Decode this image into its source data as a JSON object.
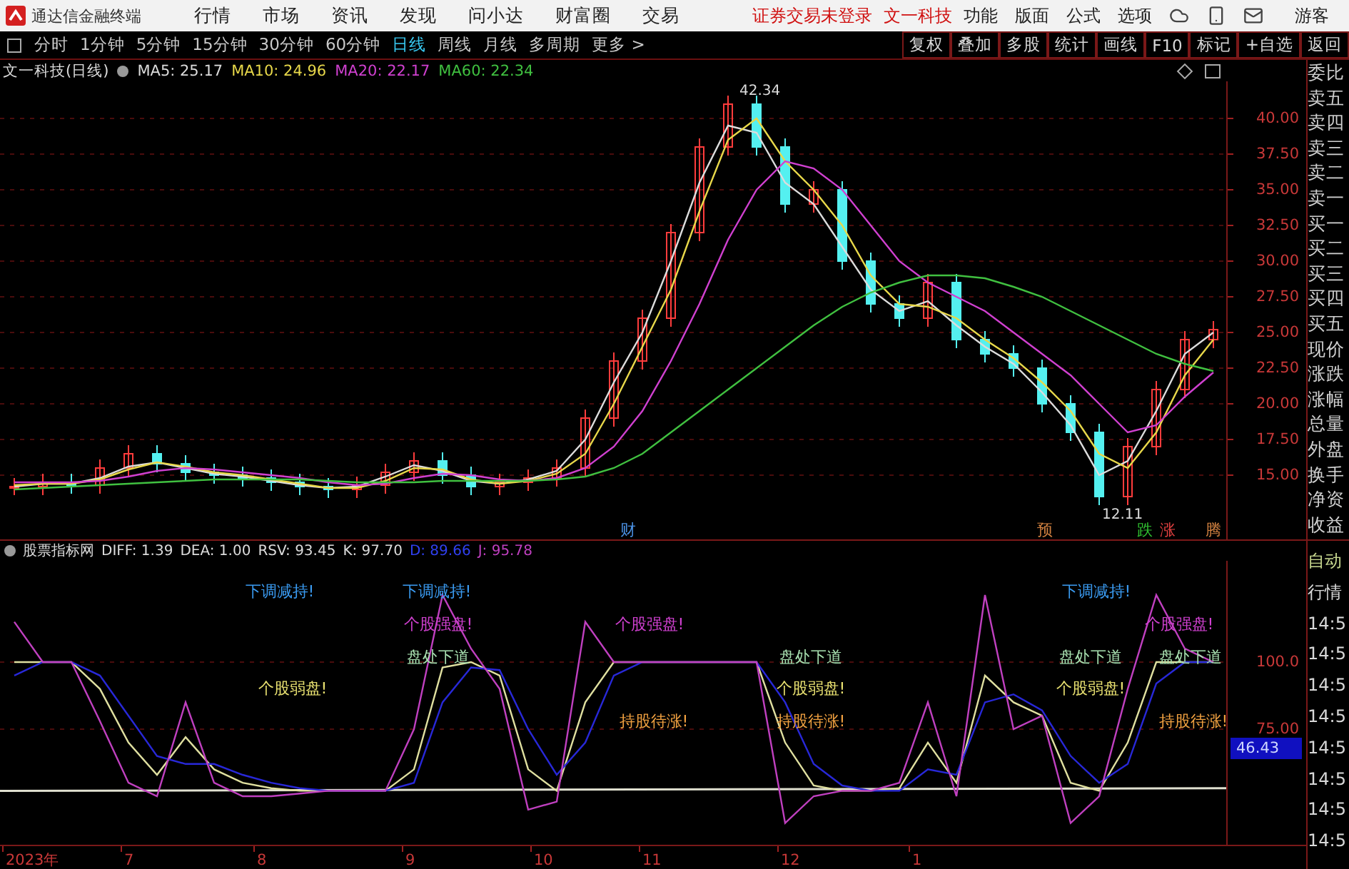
{
  "app_bar": {
    "title": "通达信金融终端",
    "menu": [
      "行情",
      "市场",
      "资讯",
      "发现",
      "问小达",
      "财富圈",
      "交易"
    ],
    "notice": "证券交易未登录",
    "stock": "文一科技",
    "tools": [
      "功能",
      "版面",
      "公式",
      "选项"
    ],
    "user": "游客"
  },
  "period_bar": {
    "periods": [
      {
        "label": "分时",
        "selected": false
      },
      {
        "label": "1分钟",
        "selected": false
      },
      {
        "label": "5分钟",
        "selected": false
      },
      {
        "label": "15分钟",
        "selected": false
      },
      {
        "label": "30分钟",
        "selected": false
      },
      {
        "label": "60分钟",
        "selected": false
      },
      {
        "label": "日线",
        "selected": true
      },
      {
        "label": "周线",
        "selected": false
      },
      {
        "label": "月线",
        "selected": false
      },
      {
        "label": "多周期",
        "selected": false
      },
      {
        "label": "更多 >",
        "selected": false
      }
    ],
    "actions": [
      "复权",
      "叠加",
      "多股",
      "统计",
      "画线",
      "F10",
      "标记",
      "+自选",
      "返回"
    ]
  },
  "price_panel": {
    "title": "文一科技(日线)",
    "indicators": [
      {
        "label": "MA5: 25.17",
        "color": "#dcdcdc"
      },
      {
        "label": "MA10: 24.96",
        "color": "#e8d84a"
      },
      {
        "label": "MA20: 22.17",
        "color": "#d040d0"
      },
      {
        "label": "MA60: 22.34",
        "color": "#40c040"
      }
    ],
    "axis_labels": [
      "40.00",
      "37.50",
      "35.00",
      "32.50",
      "30.00",
      "27.50",
      "25.00",
      "22.50",
      "20.00",
      "17.50",
      "15.00"
    ],
    "price_labels": [
      "42.34",
      "12.11"
    ],
    "event_markers": [
      {
        "text": "财",
        "color": "#4a90e2"
      },
      {
        "text": "预",
        "color": "#d08040"
      },
      {
        "text": "跌",
        "color": "#30c030"
      },
      {
        "text": "涨",
        "color": "#e04040"
      },
      {
        "text": "腾",
        "color": "#d08040"
      }
    ]
  },
  "quote_labels": [
    "委比",
    "卖五",
    "卖四",
    "卖三",
    "卖二",
    "卖一",
    "买一",
    "买二",
    "买三",
    "买四",
    "买五",
    "现价",
    "涨跌",
    "涨幅",
    "总量",
    "外盘",
    "换手",
    "净资",
    "收益"
  ],
  "indicator_panel": {
    "title": "股票指标网",
    "values": [
      {
        "label": "DIFF: 1.39",
        "color": "#dcdcdc"
      },
      {
        "label": "DEA: 1.00",
        "color": "#dcdcdc"
      },
      {
        "label": "RSV: 93.45",
        "color": "#dcdcdc"
      },
      {
        "label": "K: 97.70",
        "color": "#dcdcdc"
      },
      {
        "label": "D: 89.66",
        "color": "#3040f0"
      },
      {
        "label": "J: 95.78",
        "color": "#c040c0"
      }
    ],
    "axis_labels": [
      "100.0",
      "75.00"
    ],
    "value_badge": "46.43",
    "signals": [
      {
        "text": "下调减持!",
        "color": "#3a9af0"
      },
      {
        "text": "下调减持!",
        "color": "#3a9af0"
      },
      {
        "text": "下调减持!",
        "color": "#3a9af0"
      },
      {
        "text": "个股强盘!",
        "color": "#d040d0"
      },
      {
        "text": "个股强盘!",
        "color": "#d040d0"
      },
      {
        "text": "个股强盘!",
        "color": "#d040d0"
      },
      {
        "text": "盘处下道",
        "color": "#a8e0b0"
      },
      {
        "text": "盘处下道",
        "color": "#a8e0b0"
      },
      {
        "text": "盘处下道",
        "color": "#a8e0b0"
      },
      {
        "text": "盘处下道",
        "color": "#a8e0b0"
      },
      {
        "text": "个股弱盘!",
        "color": "#e8e070"
      },
      {
        "text": "个股弱盘!",
        "color": "#e8e070"
      },
      {
        "text": "个股弱盘!",
        "color": "#e8e070"
      },
      {
        "text": "持股待涨!",
        "color": "#f0a040"
      },
      {
        "text": "持股待涨!",
        "color": "#f0a040"
      },
      {
        "text": "持股待涨!",
        "color": "#f0a040"
      }
    ]
  },
  "time_axis": [
    "2023年",
    "7",
    "8",
    "9",
    "10",
    "11",
    "12",
    "1"
  ],
  "indicator_side": [
    "自动",
    "行情",
    "14:5",
    "14:5",
    "14:5",
    "14:5",
    "14:5",
    "14:5",
    "14:5",
    "14:5"
  ]
}
